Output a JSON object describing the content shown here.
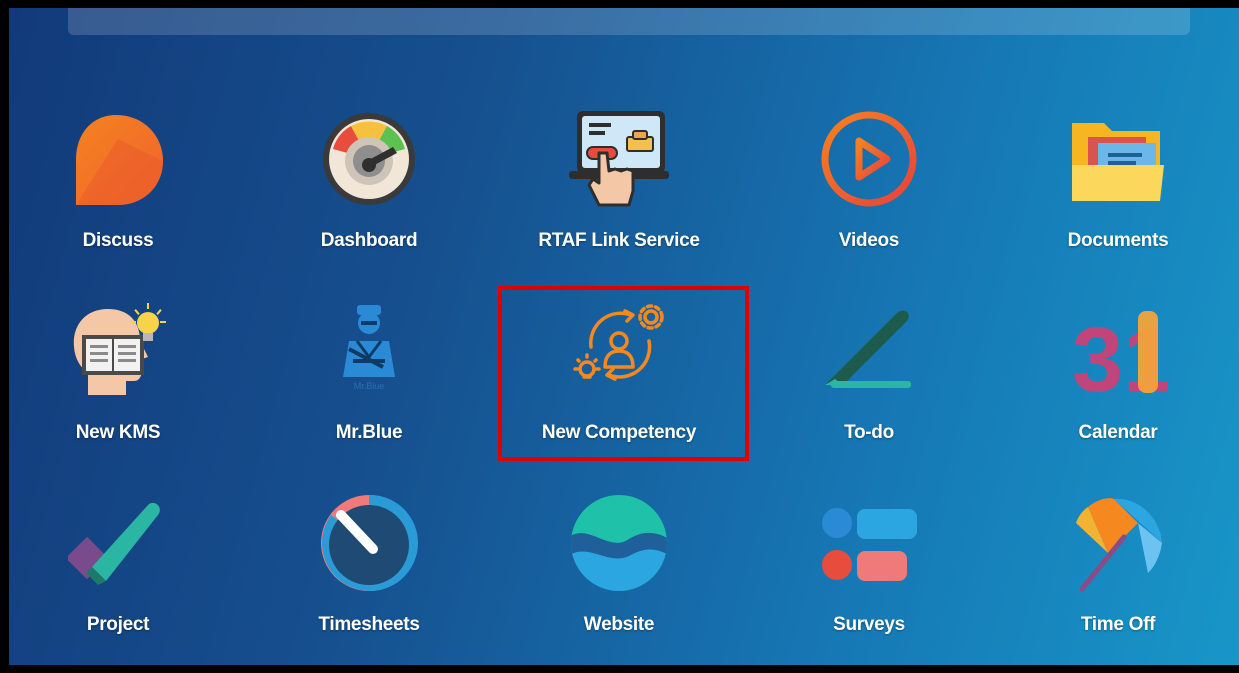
{
  "apps": [
    {
      "label": "Discuss",
      "icon": "discuss-icon"
    },
    {
      "label": "Dashboard",
      "icon": "dashboard-gauge-icon"
    },
    {
      "label": "RTAF Link Service",
      "icon": "link-service-icon"
    },
    {
      "label": "Videos",
      "icon": "play-icon"
    },
    {
      "label": "Documents",
      "icon": "folder-icon"
    },
    {
      "label": "New KMS",
      "icon": "knowledge-head-icon"
    },
    {
      "label": "Mr.Blue",
      "icon": "mr-blue-mechanic-icon",
      "icon_caption": "Mr.Blue"
    },
    {
      "label": "New Competency",
      "icon": "competency-icon"
    },
    {
      "label": "To-do",
      "icon": "todo-icon"
    },
    {
      "label": "Calendar",
      "icon": "calendar-icon",
      "icon_text": "31"
    },
    {
      "label": "Project",
      "icon": "project-check-icon"
    },
    {
      "label": "Timesheets",
      "icon": "timesheets-dial-icon"
    },
    {
      "label": "Website",
      "icon": "website-wave-icon"
    },
    {
      "label": "Surveys",
      "icon": "surveys-icon"
    },
    {
      "label": "Time Off",
      "icon": "time-off-umbrella-icon"
    }
  ],
  "highlighted_app": "New Competency",
  "colors": {
    "background_left": "#123a7a",
    "background_right": "#1896c8",
    "highlight_border": "#e00000",
    "label_text": "#ffffff"
  }
}
